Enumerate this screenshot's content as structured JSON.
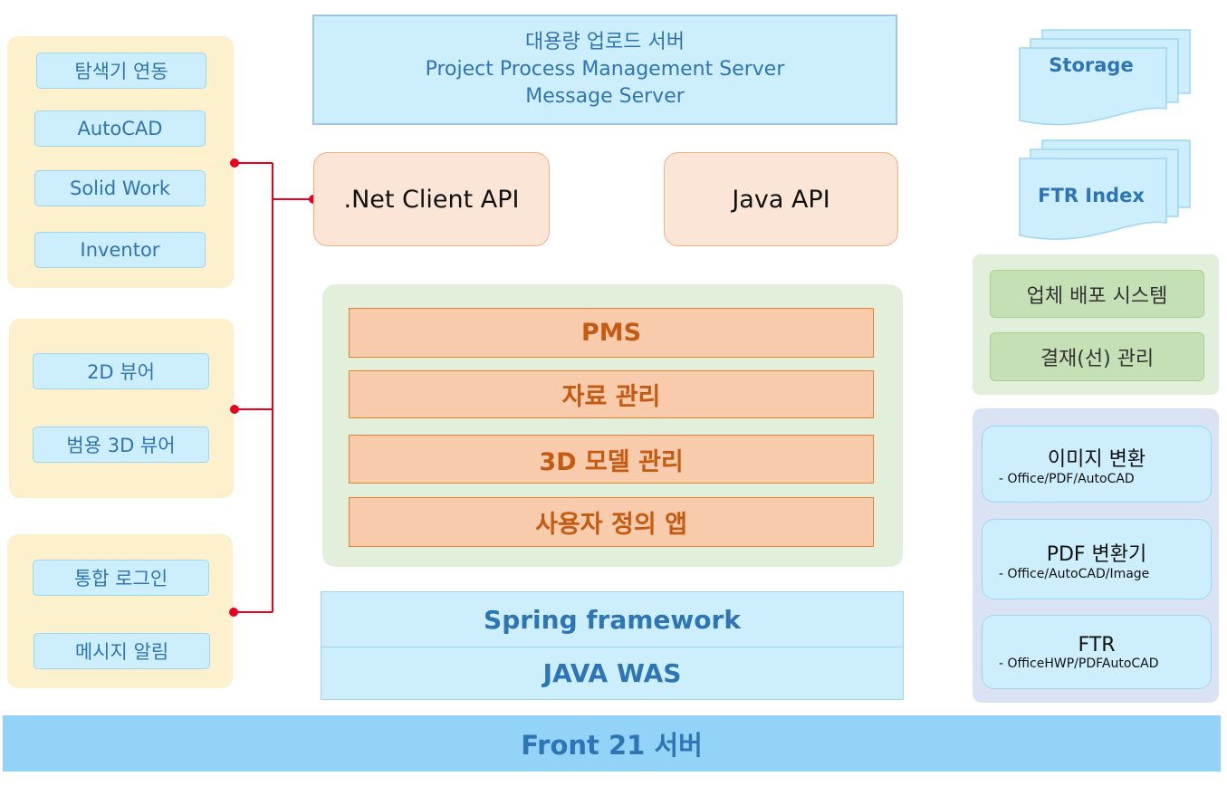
{
  "left_groups": [
    {
      "items": [
        "탐색기 연동",
        "AutoCAD",
        "Solid Work",
        "Inventor"
      ]
    },
    {
      "items": [
        "2D 뷰어",
        "범용 3D 뷰어"
      ]
    },
    {
      "items": [
        "통합 로그인",
        "메시지 알림"
      ]
    }
  ],
  "top_server": {
    "lines": [
      "대용량 업로드 서버",
      "Project Process Management Server",
      "Message Server"
    ]
  },
  "apis": {
    "net": ".Net Client API",
    "java": "Java API"
  },
  "modules": [
    "PMS",
    "자료 관리",
    "3D 모델 관리",
    "사용자 정의 앱"
  ],
  "platform": {
    "spring": "Spring framework",
    "was": "JAVA WAS"
  },
  "storage": [
    "Storage",
    "FTR Index"
  ],
  "green_services": [
    "업체 배포 시스템",
    "결재(선) 관리"
  ],
  "converters": [
    {
      "title": "이미지 변환",
      "sub": "-  Office/PDF/AutoCAD"
    },
    {
      "title": "PDF 변환기",
      "sub": "-  Office/AutoCAD/Image"
    },
    {
      "title": "FTR",
      "sub": "-  OfficeHWP/PDFAutoCAD"
    }
  ],
  "footer": "Front 21 서버",
  "colors": {
    "connector": "#e8001c",
    "accent": "#2e75b6",
    "module_text": "#c55a11"
  }
}
